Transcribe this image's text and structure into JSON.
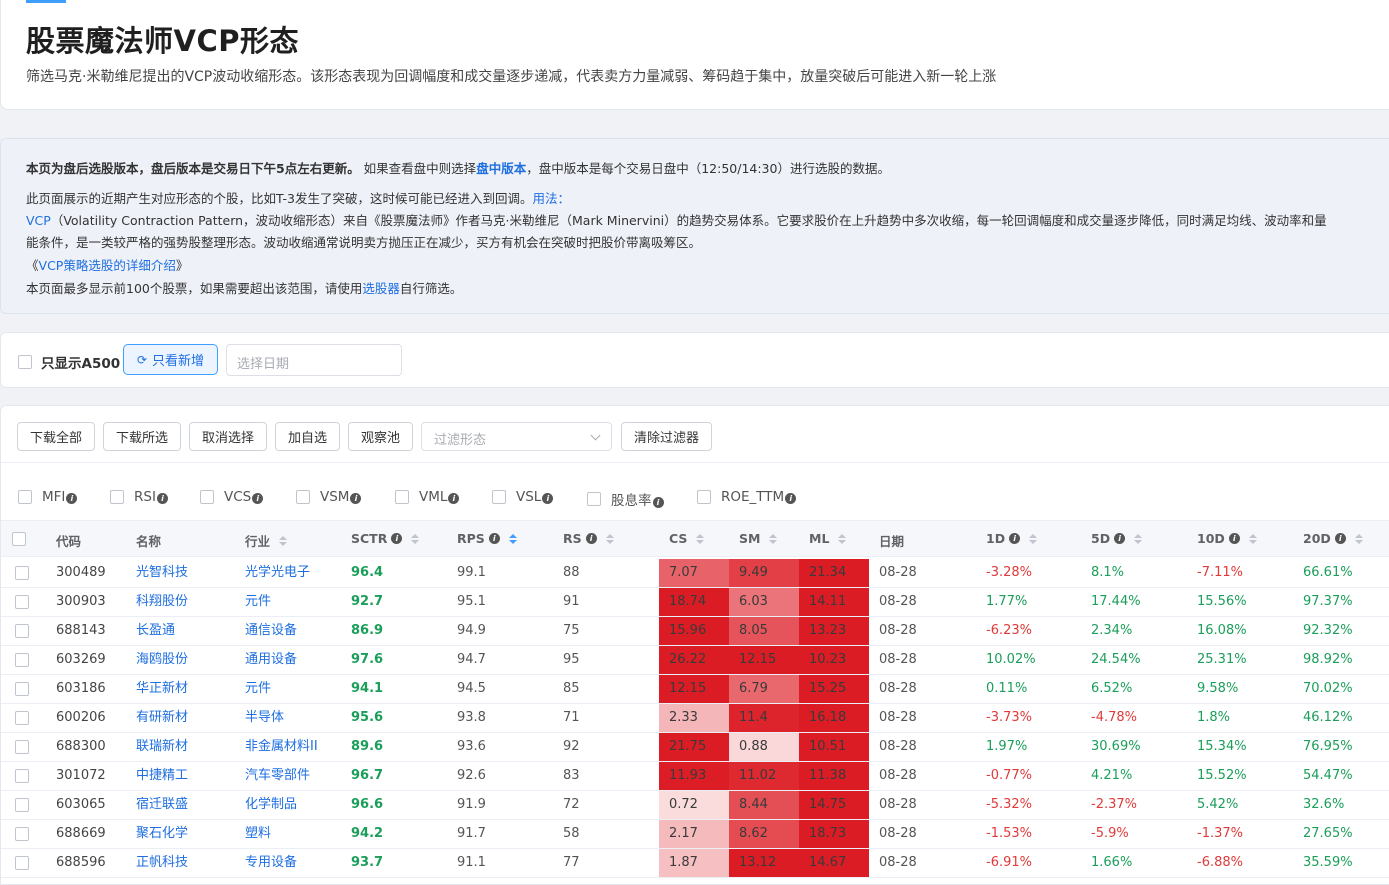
{
  "header": {
    "title": "股票魔法师VCP形态",
    "subtitle": "筛选马克·米勒维尼提出的VCP波动收缩形态。该形态表现为回调幅度和成交量逐步递减，代表卖方力量减弱、筹码趋于集中，放量突破后可能进入新一轮上涨"
  },
  "info": {
    "l1_bold": "本页为盘后选股版本，盘后版本是交易日下午5点左右更新。",
    "l1_text": " 如果查看盘中则选择",
    "l1_link": "盘中版本",
    "l1_tail": "，盘中版本是每个交易日盘中（12:50/14:30）进行选股的数据。",
    "l2_text": "此页面展示的近期产生对应形态的个股，比如T-3发生了突破，这时候可能已经进入到回调。",
    "l2_link": "用法：",
    "l3_link": "VCP",
    "l3_text": "（Volatility Contraction Pattern，波动收缩形态）来自《股票魔法师》作者马克·米勒维尼（Mark Minervini）的趋势交易体系。它要求股价在上升趋势中多次收缩，每一轮回调幅度和成交量逐步降低，同时满足均线、波动率和量",
    "l4_text": "能条件，是一类较严格的强势股整理形态。波动收缩通常说明卖方抛压正在减少，买方有机会在突破时把股价带离吸筹区。",
    "l5_open": "《",
    "l5_link": "VCP策略选股的详细介绍",
    "l5_close": "》",
    "l6_text": "本页面最多显示前100个股票，如果需要超出该范围，请使用",
    "l6_link": "选股器",
    "l6_tail": "自行筛选。"
  },
  "filters": {
    "a500_label": "只显示A500",
    "new_only_label": "只看新增",
    "date_placeholder": "选择日期"
  },
  "toolbar": {
    "download_all": "下载全部",
    "download_selected": "下载所选",
    "cancel_select": "取消选择",
    "add_watch": "加自选",
    "observe_pool": "观察池",
    "pattern_placeholder": "过滤形态",
    "clear_filters": "清除过滤器"
  },
  "column_toggles": [
    "MFI",
    "RSI",
    "VCS",
    "VSM",
    "VML",
    "VSL",
    "股息率",
    "ROE_TTM"
  ],
  "columns": {
    "code": "代码",
    "name": "名称",
    "industry": "行业",
    "sctr": "SCTR",
    "rps": "RPS",
    "rs": "RS",
    "cs": "CS",
    "sm": "SM",
    "ml": "ML",
    "date": "日期",
    "d1": "1D",
    "d5": "5D",
    "d10": "10D",
    "d20": "20D"
  },
  "colors": {
    "accent": "#409eff",
    "positive": "#1a9e5a",
    "negative": "#e03a3a",
    "heat_max": "#dc1c24"
  },
  "rows": [
    {
      "code": "300489",
      "name": "光智科技",
      "industry": "光学光电子",
      "sctr": "96.4",
      "rps": "99.1",
      "rs": "88",
      "cs": "7.07",
      "sm": "9.49",
      "ml": "21.34",
      "date": "08-28",
      "d1": "-3.28%",
      "d5": "8.1%",
      "d10": "-7.11%",
      "d20": "66.61%"
    },
    {
      "code": "300903",
      "name": "科翔股份",
      "industry": "元件",
      "sctr": "92.7",
      "rps": "95.1",
      "rs": "91",
      "cs": "18.74",
      "sm": "6.03",
      "ml": "14.11",
      "date": "08-28",
      "d1": "1.77%",
      "d5": "17.44%",
      "d10": "15.56%",
      "d20": "97.37%"
    },
    {
      "code": "688143",
      "name": "长盈通",
      "industry": "通信设备",
      "sctr": "86.9",
      "rps": "94.9",
      "rs": "75",
      "cs": "15.96",
      "sm": "8.05",
      "ml": "13.23",
      "date": "08-28",
      "d1": "-6.23%",
      "d5": "2.34%",
      "d10": "16.08%",
      "d20": "92.32%"
    },
    {
      "code": "603269",
      "name": "海鸥股份",
      "industry": "通用设备",
      "sctr": "97.6",
      "rps": "94.7",
      "rs": "95",
      "cs": "26.22",
      "sm": "12.15",
      "ml": "10.23",
      "date": "08-28",
      "d1": "10.02%",
      "d5": "24.54%",
      "d10": "25.31%",
      "d20": "98.92%"
    },
    {
      "code": "603186",
      "name": "华正新材",
      "industry": "元件",
      "sctr": "94.1",
      "rps": "94.5",
      "rs": "85",
      "cs": "12.15",
      "sm": "6.79",
      "ml": "15.25",
      "date": "08-28",
      "d1": "0.11%",
      "d5": "6.52%",
      "d10": "9.58%",
      "d20": "70.02%"
    },
    {
      "code": "600206",
      "name": "有研新材",
      "industry": "半导体",
      "sctr": "95.6",
      "rps": "93.8",
      "rs": "71",
      "cs": "2.33",
      "sm": "11.4",
      "ml": "16.18",
      "date": "08-28",
      "d1": "-3.73%",
      "d5": "-4.78%",
      "d10": "1.8%",
      "d20": "46.12%"
    },
    {
      "code": "688300",
      "name": "联瑞新材",
      "industry": "非金属材料II",
      "sctr": "89.6",
      "rps": "93.6",
      "rs": "92",
      "cs": "21.75",
      "sm": "0.88",
      "ml": "10.51",
      "date": "08-28",
      "d1": "1.97%",
      "d5": "30.69%",
      "d10": "15.34%",
      "d20": "76.95%"
    },
    {
      "code": "301072",
      "name": "中捷精工",
      "industry": "汽车零部件",
      "sctr": "96.7",
      "rps": "92.6",
      "rs": "83",
      "cs": "11.93",
      "sm": "11.02",
      "ml": "11.38",
      "date": "08-28",
      "d1": "-0.77%",
      "d5": "4.21%",
      "d10": "15.52%",
      "d20": "54.47%"
    },
    {
      "code": "603065",
      "name": "宿迁联盛",
      "industry": "化学制品",
      "sctr": "96.6",
      "rps": "91.9",
      "rs": "72",
      "cs": "0.72",
      "sm": "8.44",
      "ml": "14.75",
      "date": "08-28",
      "d1": "-5.32%",
      "d5": "-2.37%",
      "d10": "5.42%",
      "d20": "32.6%"
    },
    {
      "code": "688669",
      "name": "聚石化学",
      "industry": "塑料",
      "sctr": "94.2",
      "rps": "91.7",
      "rs": "58",
      "cs": "2.17",
      "sm": "8.62",
      "ml": "18.73",
      "date": "08-28",
      "d1": "-1.53%",
      "d5": "-5.9%",
      "d10": "-1.37%",
      "d20": "27.65%"
    },
    {
      "code": "688596",
      "name": "正帆科技",
      "industry": "专用设备",
      "sctr": "93.7",
      "rps": "91.1",
      "rs": "77",
      "cs": "1.87",
      "sm": "13.12",
      "ml": "14.67",
      "date": "08-28",
      "d1": "-6.91%",
      "d5": "1.66%",
      "d10": "-6.88%",
      "d20": "35.59%"
    }
  ]
}
